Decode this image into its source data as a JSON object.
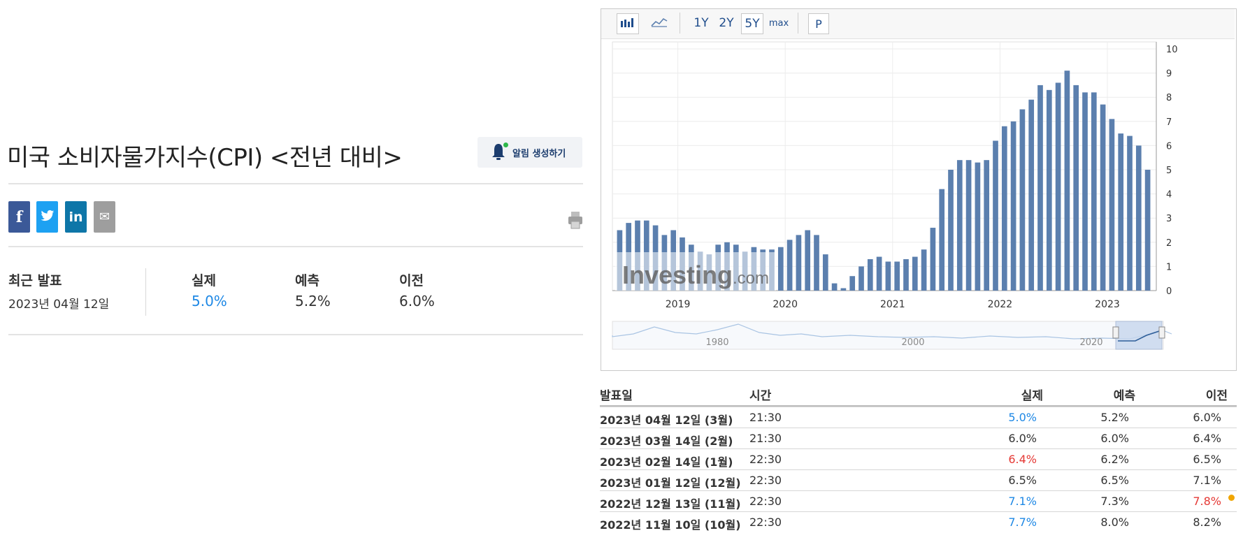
{
  "title": "미국 소비자물가지수(CPI) <전년 대비>",
  "alert_label": "알림 생성하기",
  "social": [
    {
      "name": "facebook",
      "glyph": "f",
      "color": "#3b5998"
    },
    {
      "name": "twitter",
      "glyph": "t",
      "color": "#1da1f2"
    },
    {
      "name": "linkedin",
      "glyph": "in",
      "color": "#0e76a8"
    },
    {
      "name": "email",
      "glyph": "✉",
      "color": "#9e9e9e"
    }
  ],
  "latest": {
    "label": "최근 발표",
    "date": "2023년 04월 12일",
    "actual_label": "실제",
    "actual": "5.0%",
    "forecast_label": "예측",
    "forecast": "5.2%",
    "previous_label": "이전",
    "previous": "6.0%"
  },
  "toolbar": {
    "ranges": [
      "1Y",
      "2Y",
      "5Y",
      "max"
    ],
    "active_range": "5Y",
    "p_label": "P"
  },
  "chart_data": {
    "type": "bar",
    "y_ticks": [
      0,
      1,
      2,
      3,
      4,
      5,
      6,
      7,
      8,
      9,
      10
    ],
    "ylim": [
      0,
      10
    ],
    "x_labels": [
      "2019",
      "2020",
      "2021",
      "2022",
      "2023"
    ],
    "values": [
      2.5,
      2.8,
      2.9,
      2.9,
      2.7,
      2.3,
      2.5,
      2.2,
      1.9,
      1.6,
      1.5,
      1.9,
      2.0,
      1.9,
      1.6,
      1.8,
      1.7,
      1.7,
      1.8,
      2.1,
      2.3,
      2.5,
      2.3,
      1.5,
      0.3,
      0.1,
      0.6,
      1.0,
      1.3,
      1.4,
      1.2,
      1.2,
      1.3,
      1.4,
      1.7,
      2.6,
      4.2,
      5.0,
      5.4,
      5.4,
      5.3,
      5.4,
      6.2,
      6.8,
      7.0,
      7.5,
      7.9,
      8.5,
      8.3,
      8.6,
      9.1,
      8.5,
      8.2,
      8.2,
      7.7,
      7.1,
      6.5,
      6.4,
      6.0,
      5.0
    ],
    "color": "#5b7fae",
    "navigator_labels": [
      "1980",
      "2000",
      "2020"
    ],
    "watermark": "Investing",
    "watermark_suffix": ".com",
    "grid": true
  },
  "table": {
    "headers": {
      "date": "발표일",
      "time": "시간",
      "actual": "실제",
      "forecast": "예측",
      "previous": "이전"
    },
    "rows": [
      {
        "date": "2023년 04월 12일 (3월)",
        "time": "21:30",
        "actual": "5.0%",
        "actual_status": "pos",
        "forecast": "5.2%",
        "previous": "6.0%",
        "prev_status": "neu",
        "revised": false
      },
      {
        "date": "2023년 03월 14일 (2월)",
        "time": "21:30",
        "actual": "6.0%",
        "actual_status": "neu",
        "forecast": "6.0%",
        "previous": "6.4%",
        "prev_status": "neu",
        "revised": false
      },
      {
        "date": "2023년 02월 14일 (1월)",
        "time": "22:30",
        "actual": "6.4%",
        "actual_status": "neg",
        "forecast": "6.2%",
        "previous": "6.5%",
        "prev_status": "neu",
        "revised": false
      },
      {
        "date": "2023년 01월 12일 (12월)",
        "time": "22:30",
        "actual": "6.5%",
        "actual_status": "neu",
        "forecast": "6.5%",
        "previous": "7.1%",
        "prev_status": "neu",
        "revised": false
      },
      {
        "date": "2022년 12월 13일 (11월)",
        "time": "22:30",
        "actual": "7.1%",
        "actual_status": "pos",
        "forecast": "7.3%",
        "previous": "7.8%",
        "prev_status": "neg",
        "revised": true
      },
      {
        "date": "2022년 11월 10일 (10월)",
        "time": "22:30",
        "actual": "7.7%",
        "actual_status": "pos",
        "forecast": "8.0%",
        "previous": "8.2%",
        "prev_status": "neu",
        "revised": false
      }
    ]
  }
}
